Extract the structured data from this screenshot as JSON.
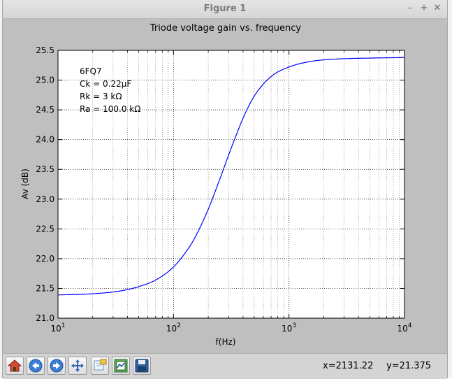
{
  "window": {
    "title": "Figure 1",
    "controls": {
      "minimize": "–",
      "maximize": "+",
      "close": "✕"
    }
  },
  "toolbar": {
    "tools": [
      {
        "id": "home",
        "icon": "home-icon"
      },
      {
        "id": "back",
        "icon": "back-arrow-icon"
      },
      {
        "id": "forward",
        "icon": "forward-arrow-icon"
      },
      {
        "id": "pan",
        "icon": "pan-move-icon"
      },
      {
        "id": "zoom",
        "icon": "zoom-rect-icon"
      },
      {
        "id": "configure",
        "icon": "configure-subplots-icon"
      },
      {
        "id": "save",
        "icon": "save-floppy-icon"
      }
    ],
    "cursor_x": "x=2131.22",
    "cursor_y": "y=21.375"
  },
  "chart_data": {
    "type": "line",
    "title": "Triode voltage gain vs. frequency",
    "xlabel": "f(Hz)",
    "ylabel": "Av (dB)",
    "xscale": "log",
    "xlim": [
      10,
      10000
    ],
    "ylim": [
      21.0,
      25.5
    ],
    "grid": true,
    "line_color": "#0000ff",
    "x_ticks": [
      {
        "value": 10,
        "base": "10",
        "exp": "1"
      },
      {
        "value": 100,
        "base": "10",
        "exp": "2"
      },
      {
        "value": 1000,
        "base": "10",
        "exp": "3"
      },
      {
        "value": 10000,
        "base": "10",
        "exp": "4"
      }
    ],
    "y_ticks": [
      "21.0",
      "21.5",
      "22.0",
      "22.5",
      "23.0",
      "23.5",
      "24.0",
      "24.5",
      "25.0",
      "25.5"
    ],
    "annotations": [
      "6FQ7",
      "Ck = 0.22μF",
      "Rk = 3 kΩ",
      "Ra = 100.0 kΩ"
    ],
    "series": [
      {
        "x": [
          10,
          20,
          30,
          40,
          50,
          70,
          100,
          130,
          150,
          200,
          250,
          300,
          350,
          400,
          500,
          700,
          1000,
          1500,
          2000,
          3000,
          5000,
          10000
        ],
        "y": [
          21.39,
          21.41,
          21.44,
          21.48,
          21.53,
          21.64,
          21.86,
          22.13,
          22.32,
          22.83,
          23.32,
          23.74,
          24.08,
          24.36,
          24.73,
          25.06,
          25.22,
          25.31,
          25.34,
          25.36,
          25.37,
          25.38
        ]
      }
    ]
  }
}
